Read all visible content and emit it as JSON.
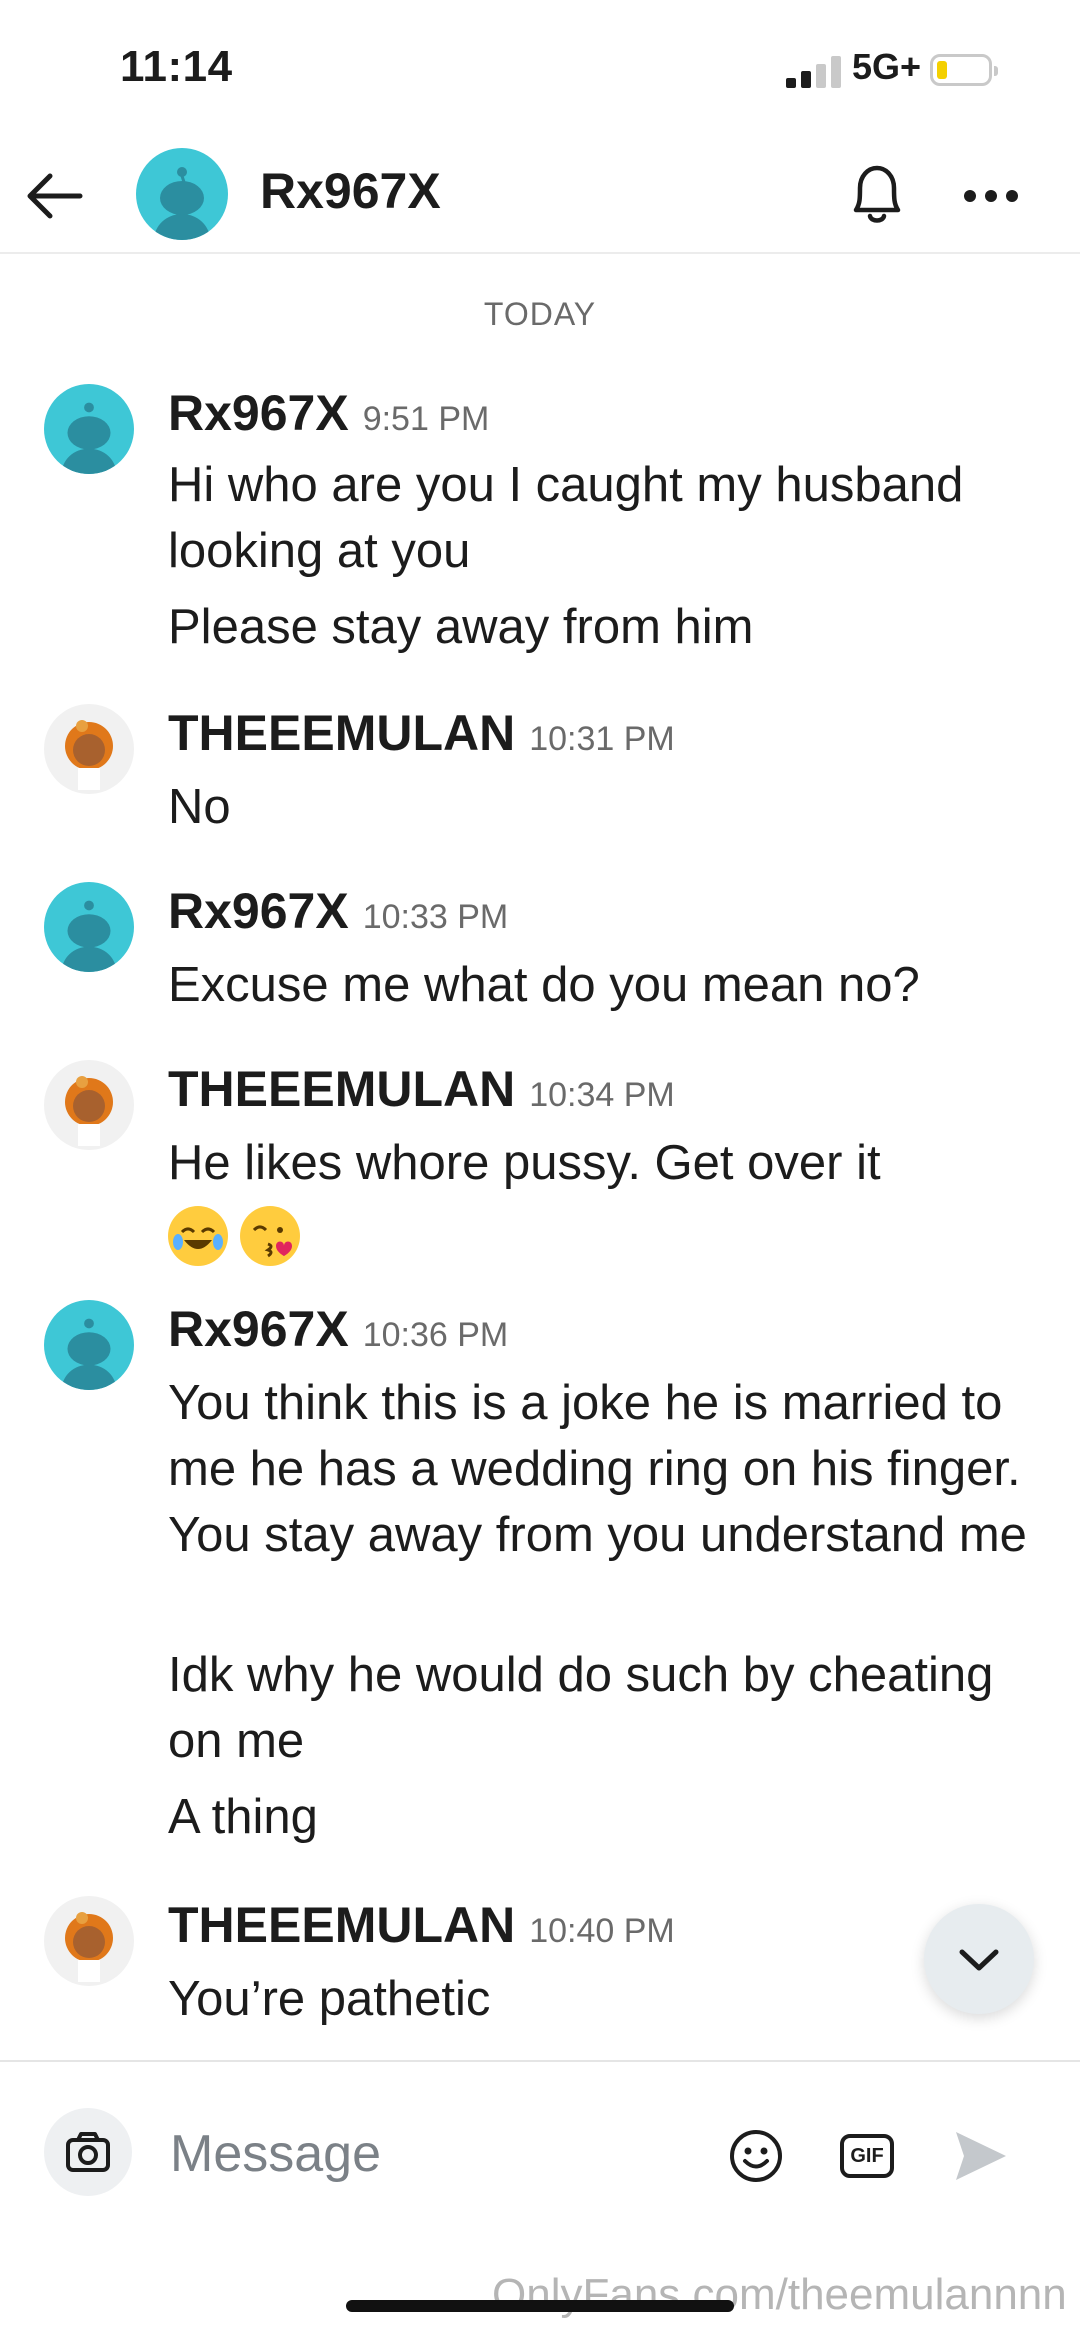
{
  "status_bar": {
    "time": "11:14",
    "network": "5G+"
  },
  "header": {
    "title": "Rx967X"
  },
  "day_label": "TODAY",
  "messages": [
    {
      "sender": "Rx967X",
      "time": "9:51 PM",
      "lines": [
        "Hi who are you I caught my husband looking at you",
        "Please stay away from him"
      ]
    },
    {
      "sender": "THEEEMULAN",
      "time": "10:31 PM",
      "lines": [
        "No"
      ]
    },
    {
      "sender": "Rx967X",
      "time": "10:33 PM",
      "lines": [
        "Excuse me what do you mean no?"
      ]
    },
    {
      "sender": "THEEEMULAN",
      "time": "10:34 PM",
      "lines": [
        "He likes whore pussy. Get over it"
      ],
      "emojis": [
        "laughing-emoji",
        "kiss-emoji"
      ]
    },
    {
      "sender": "Rx967X",
      "time": "10:36 PM",
      "lines": [
        "You think this is a joke he is married to me he has a wedding ring on his finger. You stay away from you understand me",
        "Idk why he would do such by cheating on me",
        "A thing"
      ]
    },
    {
      "sender": "THEEEMULAN",
      "time": "10:40 PM",
      "lines": [
        "You’re pathetic"
      ]
    }
  ],
  "composer": {
    "placeholder": "Message",
    "gif_label": "GIF"
  },
  "watermark": "OnlyFans.com/theemulannnn",
  "colors": {
    "snoo_avatar": "#3ec7d6",
    "text": "#1c1c1c",
    "muted": "#6a6a6a"
  }
}
